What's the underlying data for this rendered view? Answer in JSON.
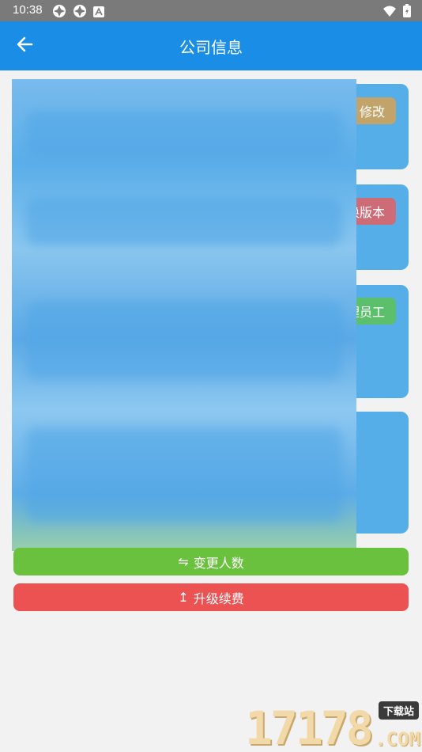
{
  "status_bar": {
    "time": "10:38",
    "left_icons": [
      "android-debug-icon",
      "android-debug-icon",
      "notification-a-icon"
    ],
    "right_icons": [
      "wifi-icon",
      "battery-charging-icon"
    ]
  },
  "app_bar": {
    "back_icon": "arrow-left-icon",
    "title": "公司信息"
  },
  "cards": {
    "edit_label": "修改",
    "version_label": "换版本",
    "staff_label": "理员工"
  },
  "actions": {
    "change_count": {
      "icon": "swap-icon",
      "icon_glyph": "⇋",
      "label": "变更人数"
    },
    "upgrade_renew": {
      "icon": "upload-icon",
      "icon_glyph": "↥",
      "label": "升级续费"
    }
  },
  "watermark": {
    "digits": "17178",
    "tag": "下载站",
    "suffix": ".COM"
  },
  "colors": {
    "status_bar": "#7a7a7a",
    "app_bar": "#1a8ee6",
    "background": "#f2f2f2",
    "card": "#56aee8",
    "edit_chip": "#c2a46b",
    "version_chip": "#cd6b77",
    "staff_chip": "#5cbf6b",
    "change_count": "#6ac13e",
    "upgrade_renew": "#ec5252"
  }
}
